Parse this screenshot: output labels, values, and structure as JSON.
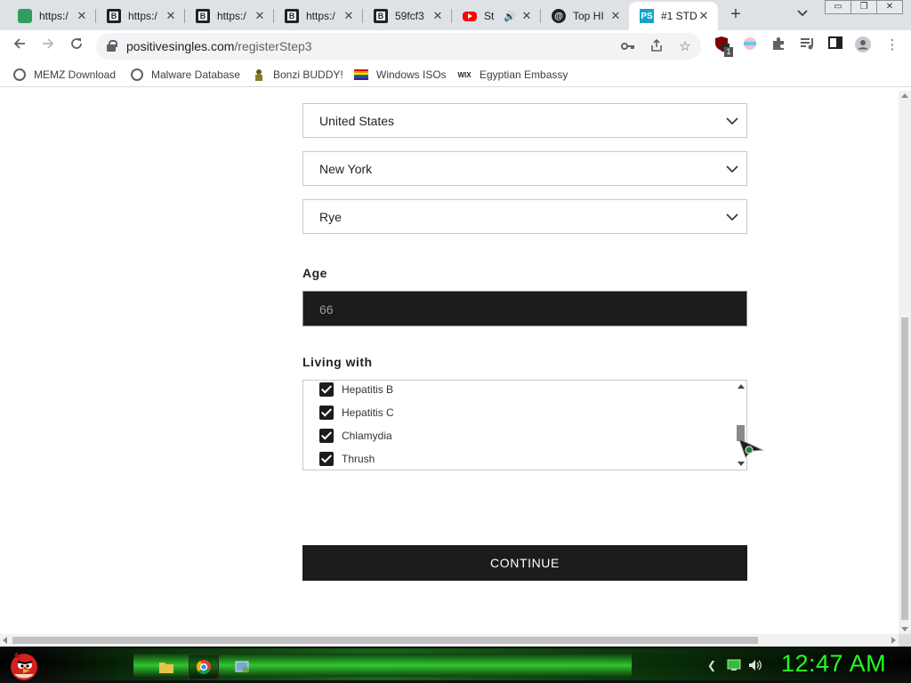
{
  "browser": {
    "tabs": [
      {
        "title": "https:/",
        "favicon": "green-app-icon",
        "active": false
      },
      {
        "title": "https:/",
        "favicon": "b-logo-icon",
        "active": false
      },
      {
        "title": "https:/",
        "favicon": "b-logo-icon",
        "active": false
      },
      {
        "title": "https:/",
        "favicon": "b-logo-icon",
        "active": false
      },
      {
        "title": "59fcf3",
        "favicon": "b-logo-icon",
        "active": false
      },
      {
        "title": "St",
        "favicon": "youtube-icon",
        "active": false,
        "audio": true
      },
      {
        "title": "Top HI",
        "favicon": "threads-icon",
        "active": false
      },
      {
        "title": "#1 STD",
        "favicon": "ps-logo-icon",
        "active": true
      }
    ],
    "new_tab_label": "+",
    "url_host": "positivesingles.com",
    "url_path": "/registerStep3",
    "bookmarks": [
      {
        "label": "MEMZ Download",
        "icon": "globe-icon"
      },
      {
        "label": "Malware Database",
        "icon": "globe-icon"
      },
      {
        "label": "Bonzi BUDDY!",
        "icon": "bonzi-icon"
      },
      {
        "label": "Windows ISOs",
        "icon": "rainbow-flag-icon"
      },
      {
        "label": "Egyptian Embassy",
        "icon": "wix-icon"
      }
    ],
    "extension_badge": "1"
  },
  "form": {
    "country": "United States",
    "state": "New York",
    "city": "Rye",
    "age_label": "Age",
    "age_value": "66",
    "living_with_label": "Living with",
    "conditions": [
      {
        "label": "Hepatitis B",
        "checked": true
      },
      {
        "label": "Hepatitis C",
        "checked": true
      },
      {
        "label": "Chlamydia",
        "checked": true
      },
      {
        "label": "Thrush",
        "checked": true
      }
    ],
    "continue_label": "CONTINUE"
  },
  "taskbar": {
    "clock": "12:47 AM"
  },
  "colors": {
    "dark_button": "#1c1c1e",
    "clock_green": "#22ff22",
    "tabstrip": "#dee1e6"
  }
}
